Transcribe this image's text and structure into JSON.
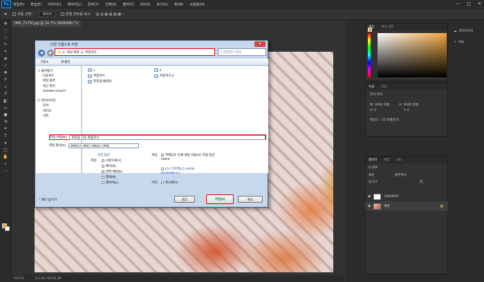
{
  "menu": [
    "파일(F)",
    "편집(E)",
    "이미지(I)",
    "레이어(L)",
    "문자(Y)",
    "선택(S)",
    "필터(T)",
    "3D(D)",
    "보기(V)",
    "창(W)",
    "도움말(H)"
  ],
  "logo": "Ps",
  "window_controls": [
    "—",
    "□",
    "✕"
  ],
  "options": {
    "auto_select": "자동 선택 :",
    "layer": "레이어",
    "transform": "변형 컨트롤 표시"
  },
  "doc_tab": {
    "title": "IMG_7175I.jpg @ 16.7% (RGB/8#) *",
    "close": "×"
  },
  "status": {
    "zoom": "16.67%",
    "doc": "문서:46.7M/161.3M"
  },
  "color_panel": {
    "tab1": "색상",
    "tab2": "색상 견본"
  },
  "props_panel": {
    "tab1": "속성",
    "tab2": "조정",
    "doc": "문서 속성",
    "w": "W:  4000 픽셀",
    "h": "H:  4000 픽셀",
    "x": "X:  0",
    "y": "Y:  0",
    "res": "해상도 : 72 픽셀/인치"
  },
  "side": {
    "library": "라이브러리",
    "learn": "학습"
  },
  "layers_panel": {
    "tabs": [
      "레이어",
      "채널",
      "패스"
    ],
    "kind": "Q 종류",
    "mode": "표준",
    "opacity": "불투명도:",
    "lock": "잠그기:",
    "fill": "칠:",
    "layers": [
      {
        "name": "1083697l"
      },
      {
        "name": "배경"
      }
    ]
  },
  "dialog": {
    "title": "다른 이름으로 저장",
    "close": "✕",
    "address": [
      "바탕 화면",
      "저장하기"
    ],
    "search_placeholder": "저장하기 검색",
    "cmd": [
      "구성 ▾",
      "새 폴더"
    ],
    "nav": [
      {
        "label": "즐겨찾기",
        "indent": false
      },
      {
        "label": "다운로드",
        "indent": true
      },
      {
        "label": "바탕 화면",
        "indent": true
      },
      {
        "label": "최근 위치",
        "indent": true
      },
      {
        "label": "Creative Cloud F",
        "indent": true
      },
      {
        "label": "",
        "indent": false
      },
      {
        "label": "라이브러리",
        "indent": false
      },
      {
        "label": "문서",
        "indent": true
      },
      {
        "label": "비디오",
        "indent": true
      },
      {
        "label": "사진",
        "indent": true
      }
    ],
    "files": [
      "1",
      "저장하기",
      "포토샵-썸네일",
      "2",
      "저장하기-2"
    ],
    "filename_label": "파일 이름(N):",
    "filename_value": "포토샵 기초 저장하기",
    "filetype_label": "파일 형식(T):",
    "filetype_value": "JPEG (*.JPG;*.JPEG;*.JPE)",
    "save_options_title": "저장 옵션",
    "save_label": "저장:",
    "save_opts": [
      "사본으로(Y)",
      "메모(N)",
      "알파 채널(E)",
      "별색(P)",
      "레이어(L)"
    ],
    "color_label": "색상:",
    "color_opts": [
      "저해상도 인쇄 설정 사용(U): 작업 중인 CMYK",
      "ICC 프로필(C): sRGB IEC61966-2.1"
    ],
    "other_label": "기타:",
    "thumb_opt": "축소판(T)",
    "hide_folders": "폴더 숨기기",
    "warn": "경고",
    "save_button": "저장(S)",
    "cancel_button": "취소"
  }
}
